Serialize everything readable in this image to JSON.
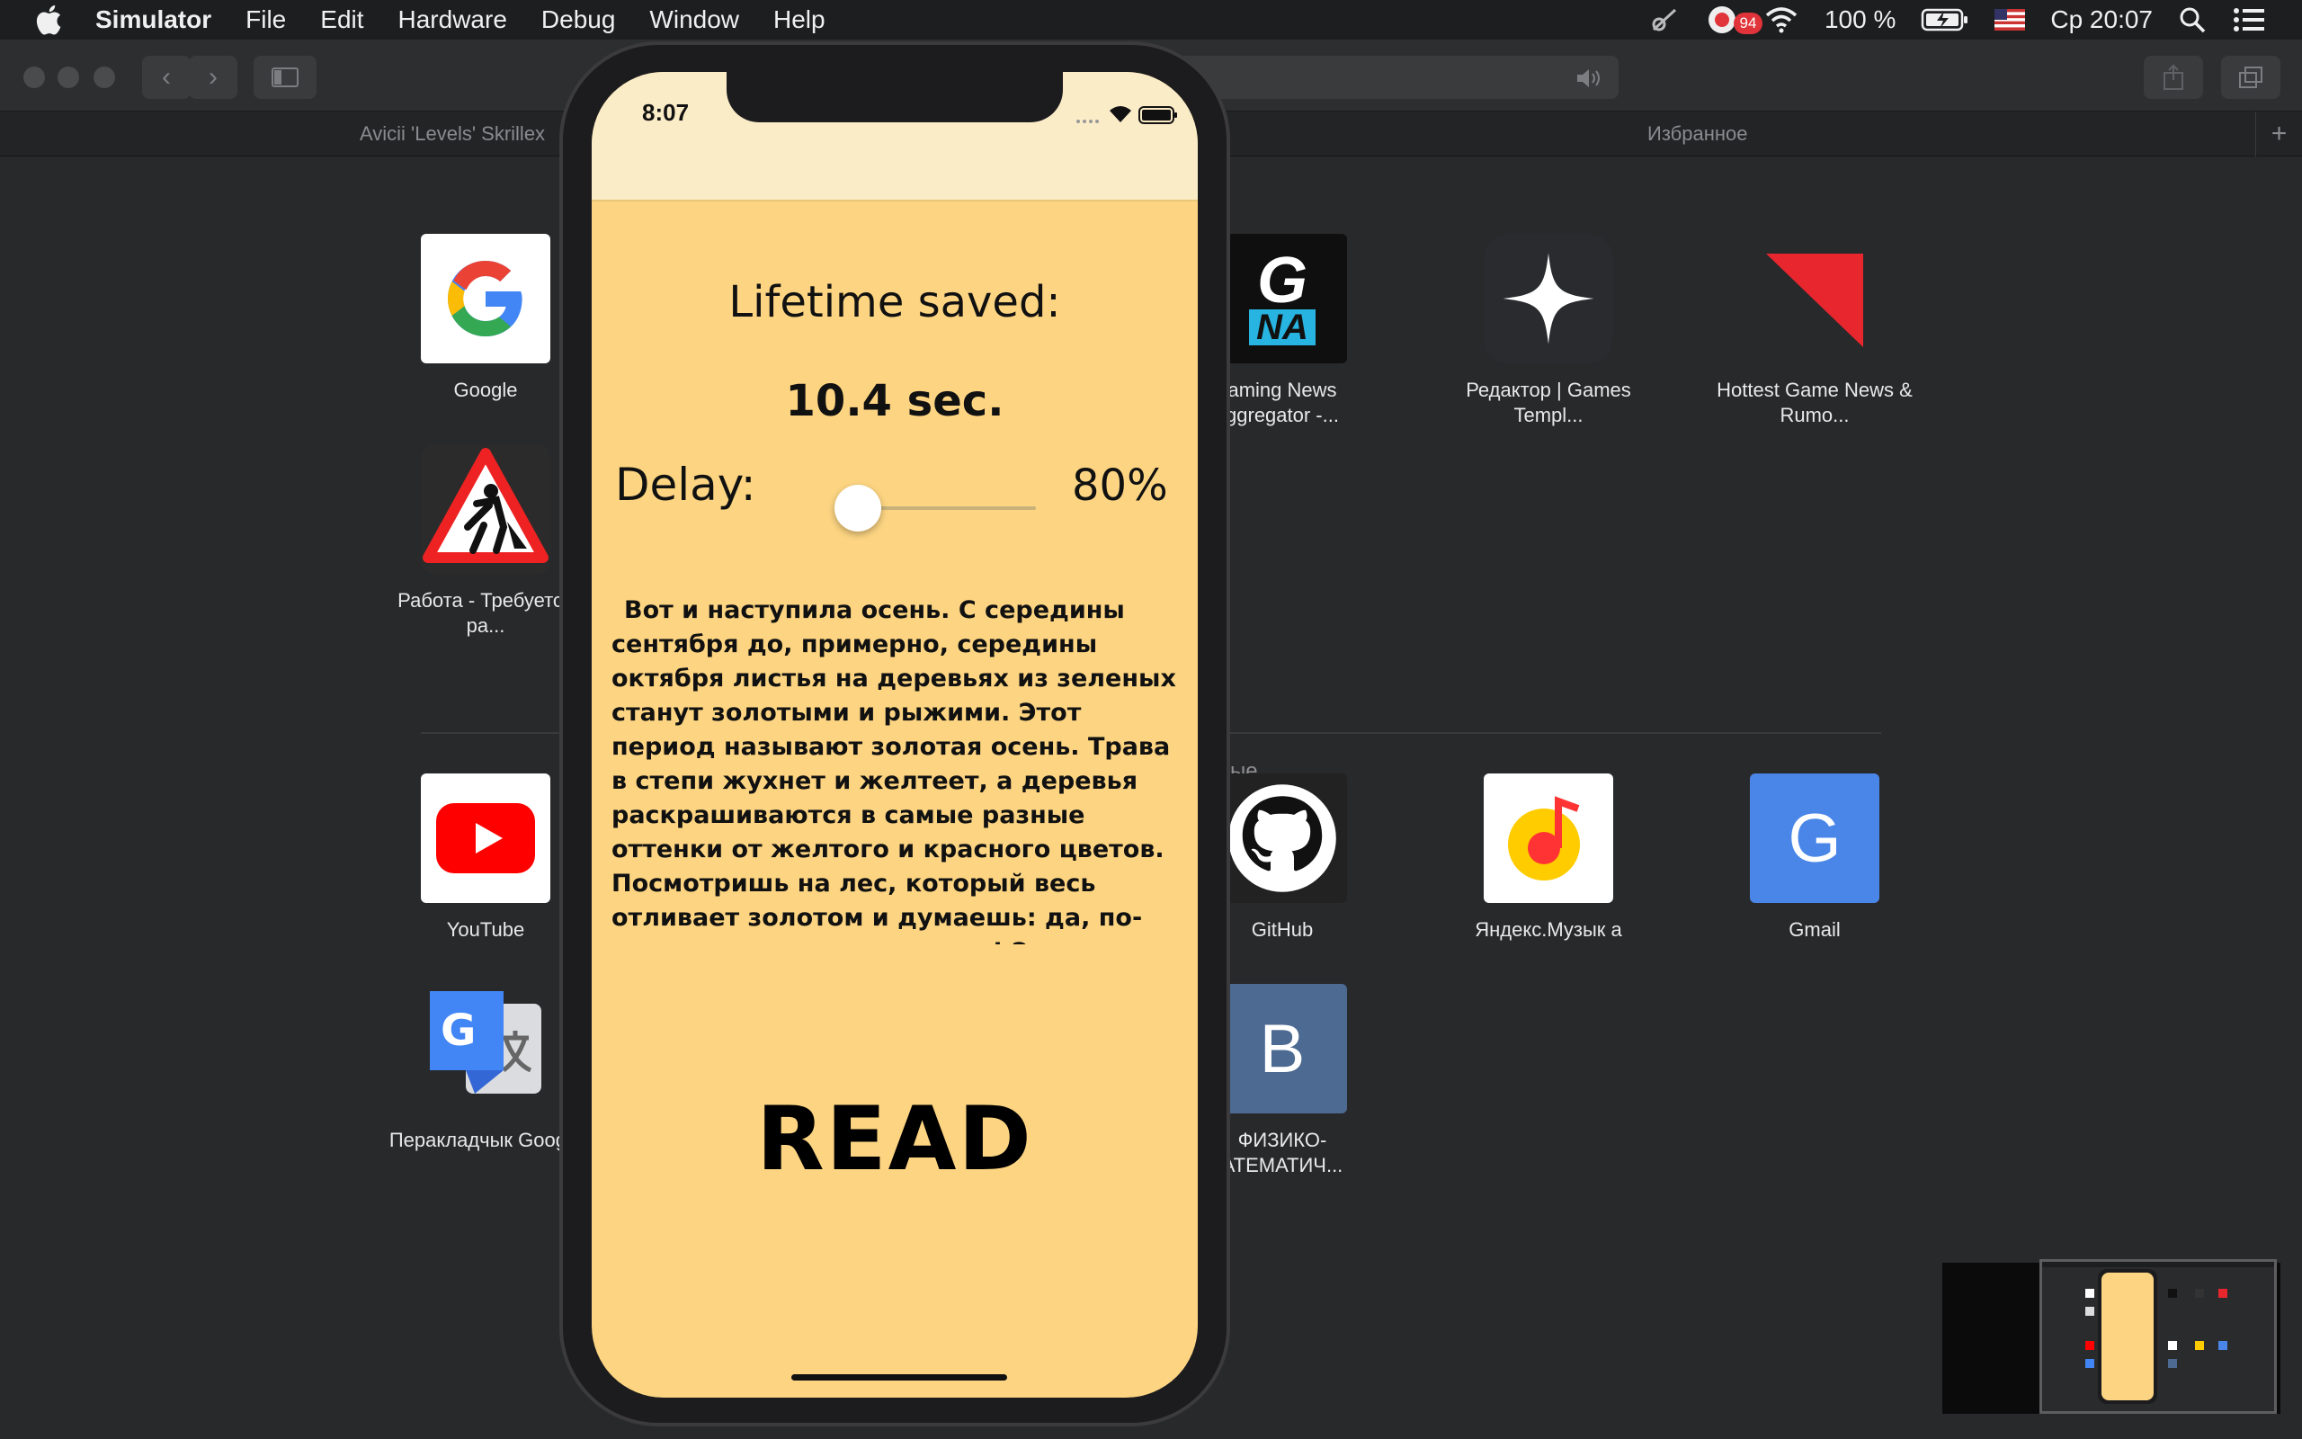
{
  "menubar": {
    "app_name": "Simulator",
    "items": [
      "File",
      "Edit",
      "Hardware",
      "Debug",
      "Window",
      "Help"
    ],
    "notification_count": "94",
    "battery": "100 %",
    "datetime": "Ср 20:07"
  },
  "safari": {
    "tabs": [
      {
        "title": "Avicii 'Levels' Skrillex"
      },
      {
        "title": "Избранное"
      }
    ],
    "favorites": [
      {
        "label": "Google"
      },
      {
        "label": "Работа - Требуется ра..."
      },
      {
        "label": "aming News ggregator -..."
      },
      {
        "label": "Редактор | Games Templ..."
      },
      {
        "label": "Hottest Game News & Rumo..."
      }
    ],
    "frequent_title": "ые",
    "frequent": [
      {
        "label": "YouTube"
      },
      {
        "label": "Перакладчык Google"
      },
      {
        "label": "GitHub"
      },
      {
        "label": "Яндекс.Музык а"
      },
      {
        "label": "Gmail"
      },
      {
        "label": "ФИЗИКО- АТЕМАТИЧ..."
      }
    ],
    "gna_text_top": "G",
    "gna_text_bottom": "NA",
    "gmail_letter": "G",
    "vk_letter": "B"
  },
  "simulator": {
    "time": "8:07",
    "lifetime_label": "Lifetime saved:",
    "lifetime_value": "10.4 sec.",
    "delay_label": "Delay:",
    "delay_value": "80%",
    "delay_slider": 0.0,
    "body_text": "Вот и наступила осень. С середины сентября до, примерно, середины октября листья на деревьях из зеленых станут золотыми и рыжими. Этот период называют золотая осень. Трава в степи жухнет и желтеет, а деревья раскрашиваются в самые разные оттенки от желтого и красного цветов. Посмотришь на лес, который весь отливает золотом и думаешь: да, по-настоящему золотая осень! Это очень красивая пора и",
    "read_label": "READ"
  },
  "colors": {
    "app_background": "#fdd582",
    "status_background": "#fbecc8",
    "window_background": "#28292b"
  }
}
